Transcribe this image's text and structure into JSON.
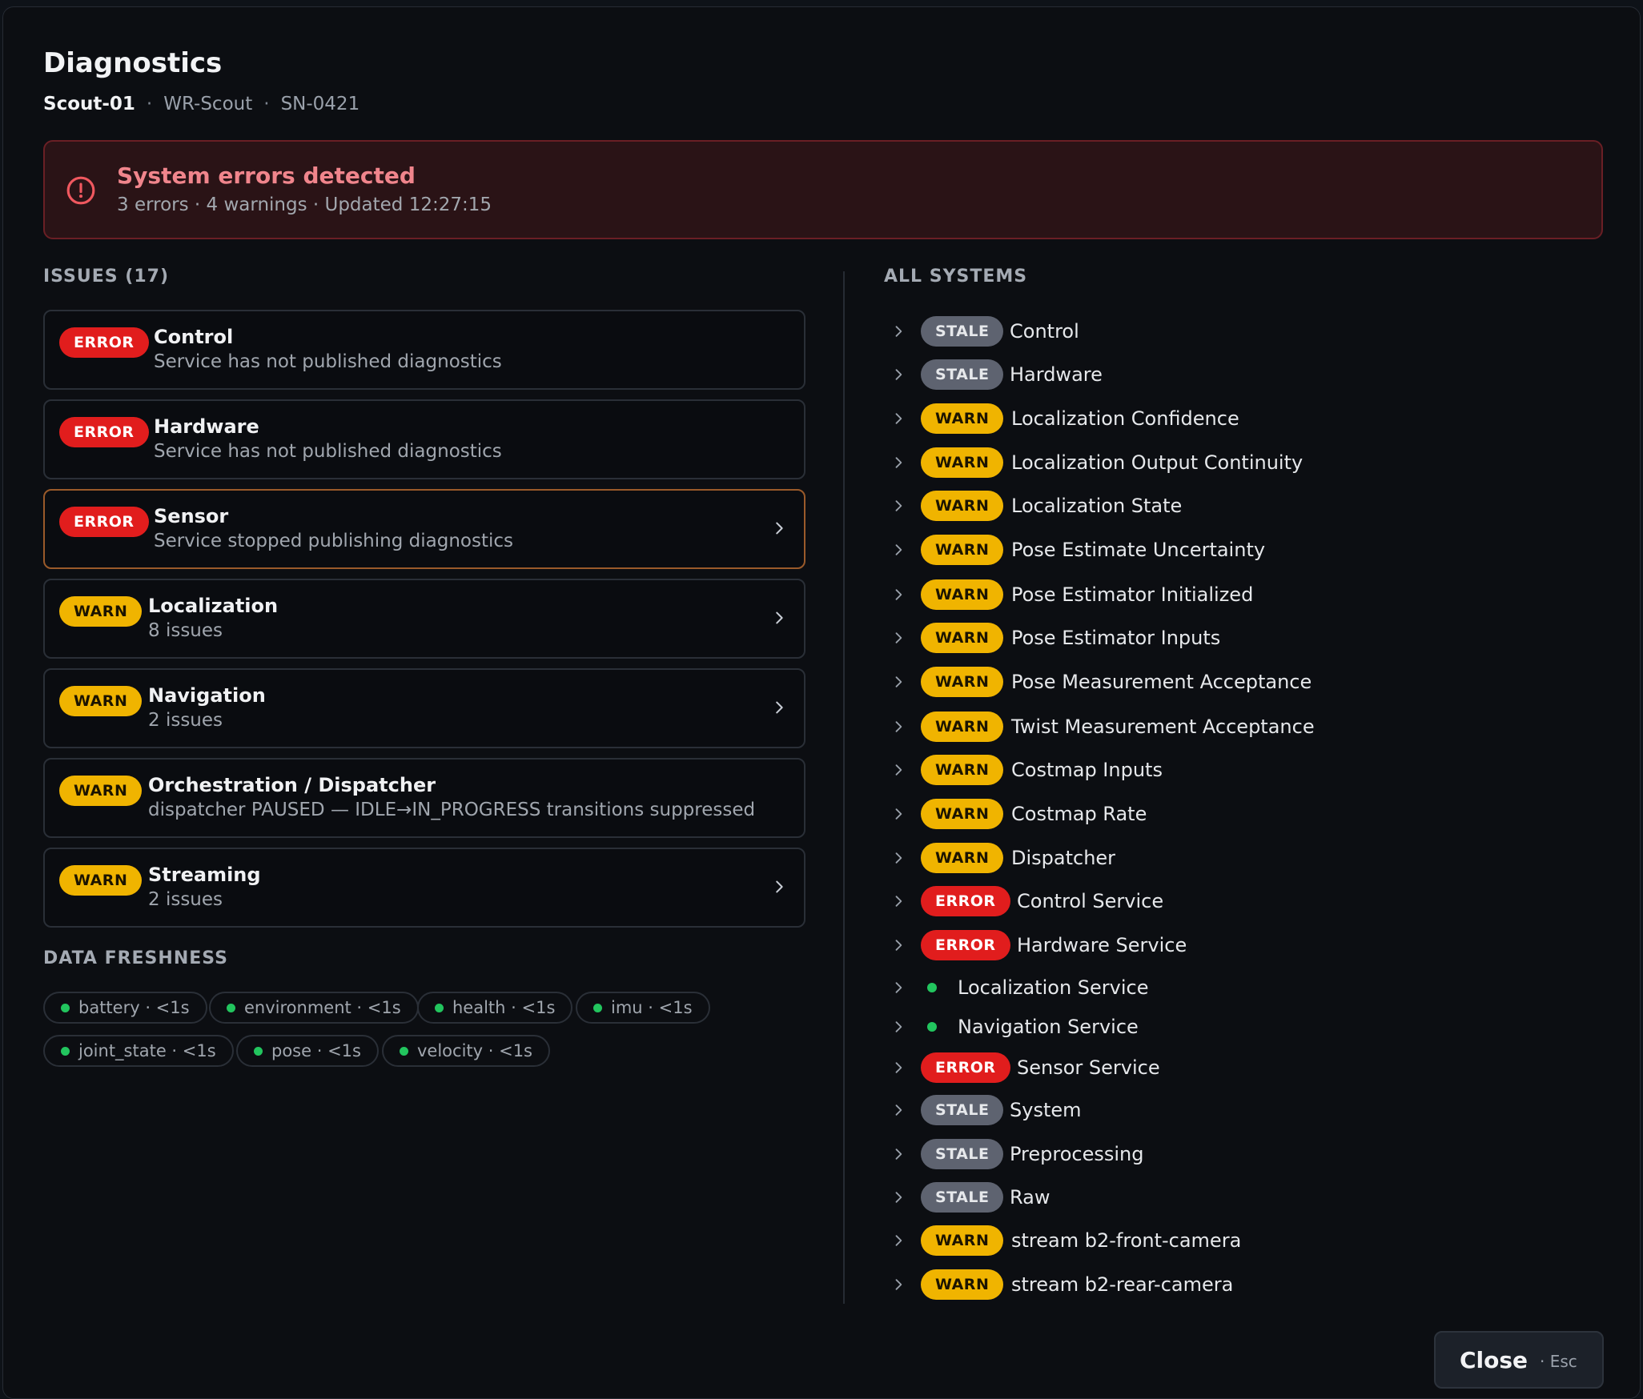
{
  "header": {
    "title": "Diagnostics",
    "robot_name": "Scout-01",
    "separator": "·",
    "robot_model": "WR-Scout",
    "serial": "SN-0421"
  },
  "alert": {
    "icon": "alert-circle-icon",
    "title": "System errors detected",
    "detail": "3 errors · 4 warnings · Updated 12:27:15",
    "color": "#f0858c"
  },
  "issues_section": {
    "label": "ISSUES (17)",
    "items": [
      {
        "level": "ERROR",
        "title": "Control",
        "description": "Service has not published diagnostics",
        "has_chevron": false,
        "selected": false
      },
      {
        "level": "ERROR",
        "title": "Hardware",
        "description": "Service has not published diagnostics",
        "has_chevron": false,
        "selected": false
      },
      {
        "level": "ERROR",
        "title": "Sensor",
        "description": "Service stopped publishing diagnostics",
        "has_chevron": true,
        "selected": true
      },
      {
        "level": "WARN",
        "title": "Localization",
        "description": "8 issues",
        "has_chevron": true,
        "selected": false
      },
      {
        "level": "WARN",
        "title": "Navigation",
        "description": "2 issues",
        "has_chevron": true,
        "selected": false
      },
      {
        "level": "WARN",
        "title": "Orchestration / Dispatcher",
        "description": "dispatcher PAUSED — IDLE→IN_PROGRESS transitions suppressed",
        "has_chevron": false,
        "selected": false
      },
      {
        "level": "WARN",
        "title": "Streaming",
        "description": "2 issues",
        "has_chevron": true,
        "selected": false
      }
    ]
  },
  "freshness": {
    "label": "DATA FRESHNESS",
    "chips": [
      {
        "label": "battery · <1s",
        "status_color": "#22c55e"
      },
      {
        "label": "environment · <1s",
        "status_color": "#22c55e"
      },
      {
        "label": "health · <1s",
        "status_color": "#22c55e"
      },
      {
        "label": "imu · <1s",
        "status_color": "#22c55e"
      },
      {
        "label": "joint_state · <1s",
        "status_color": "#22c55e"
      },
      {
        "label": "pose · <1s",
        "status_color": "#22c55e"
      },
      {
        "label": "velocity · <1s",
        "status_color": "#22c55e"
      }
    ]
  },
  "systems": {
    "label": "ALL SYSTEMS",
    "items": [
      {
        "status": "STALE",
        "name": "Control"
      },
      {
        "status": "STALE",
        "name": "Hardware"
      },
      {
        "status": "WARN",
        "name": "Localization Confidence"
      },
      {
        "status": "WARN",
        "name": "Localization Output Continuity"
      },
      {
        "status": "WARN",
        "name": "Localization State"
      },
      {
        "status": "WARN",
        "name": "Pose Estimate Uncertainty"
      },
      {
        "status": "WARN",
        "name": "Pose Estimator Initialized"
      },
      {
        "status": "WARN",
        "name": "Pose Estimator Inputs"
      },
      {
        "status": "WARN",
        "name": "Pose Measurement Acceptance"
      },
      {
        "status": "WARN",
        "name": "Twist Measurement Acceptance"
      },
      {
        "status": "WARN",
        "name": "Costmap Inputs"
      },
      {
        "status": "WARN",
        "name": "Costmap Rate"
      },
      {
        "status": "WARN",
        "name": "Dispatcher"
      },
      {
        "status": "ERROR",
        "name": "Control Service"
      },
      {
        "status": "ERROR",
        "name": "Hardware Service"
      },
      {
        "status": "OK",
        "name": "Localization Service"
      },
      {
        "status": "OK",
        "name": "Navigation Service"
      },
      {
        "status": "ERROR",
        "name": "Sensor Service"
      },
      {
        "status": "STALE",
        "name": "System"
      },
      {
        "status": "STALE",
        "name": "Preprocessing"
      },
      {
        "status": "STALE",
        "name": "Raw"
      },
      {
        "status": "WARN",
        "name": "stream b2-front-camera"
      },
      {
        "status": "WARN",
        "name": "stream b2-rear-camera"
      }
    ]
  },
  "footer": {
    "close_label": "Close",
    "close_hint": "· Esc"
  },
  "colors": {
    "error": "#e11d1d",
    "warn": "#f0b400",
    "stale": "#5e6370",
    "ok": "#22c55e"
  }
}
